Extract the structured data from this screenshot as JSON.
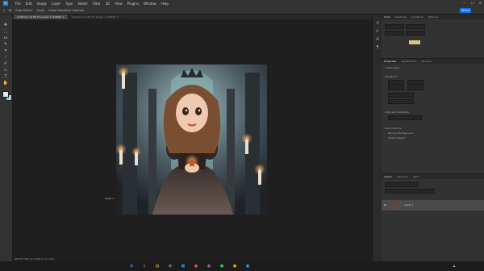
{
  "menubar": {
    "logo": "Ps",
    "items": [
      "File",
      "Edit",
      "Image",
      "Layer",
      "Type",
      "Select",
      "Filter",
      "3D",
      "View",
      "Plugins",
      "Window",
      "Help"
    ],
    "window_controls": [
      "—",
      "☐",
      "✕"
    ]
  },
  "options_bar": {
    "items": [
      "Auto-Select:",
      "Layer",
      "Show Transform Controls"
    ],
    "share_label": "Share"
  },
  "tabs": [
    {
      "label": "Untitled-1 @ 66.7% (Layer 1, RGB/8) ×"
    },
    {
      "label": "Untitled-2 @ 66.7% (Layer 1, RGB/8) ×"
    }
  ],
  "panels": {
    "top_tabs": [
      "Color",
      "Swatches",
      "Gradients",
      "Patterns"
    ],
    "mid_tabs": [
      "Properties",
      "Adjustments",
      "Libraries"
    ],
    "properties_title": "Pixel Layer",
    "sections": [
      "Transform",
      "Align and Distribute",
      "Quick Actions"
    ],
    "quick_actions": [
      "Remove Background",
      "Select Subject"
    ],
    "layers_tabs": [
      "Layers",
      "Channels",
      "Paths"
    ],
    "layer_name": "Layer 1"
  },
  "canvas": {
    "cursor_label": "Layer 1"
  },
  "status_bar": "66.67%   600 px x 600 px (72 ppi)",
  "colors": {
    "accent": "#1473e6",
    "foreground_swatch": "#e8e8e8",
    "background_swatch": "#9ed4ea"
  }
}
